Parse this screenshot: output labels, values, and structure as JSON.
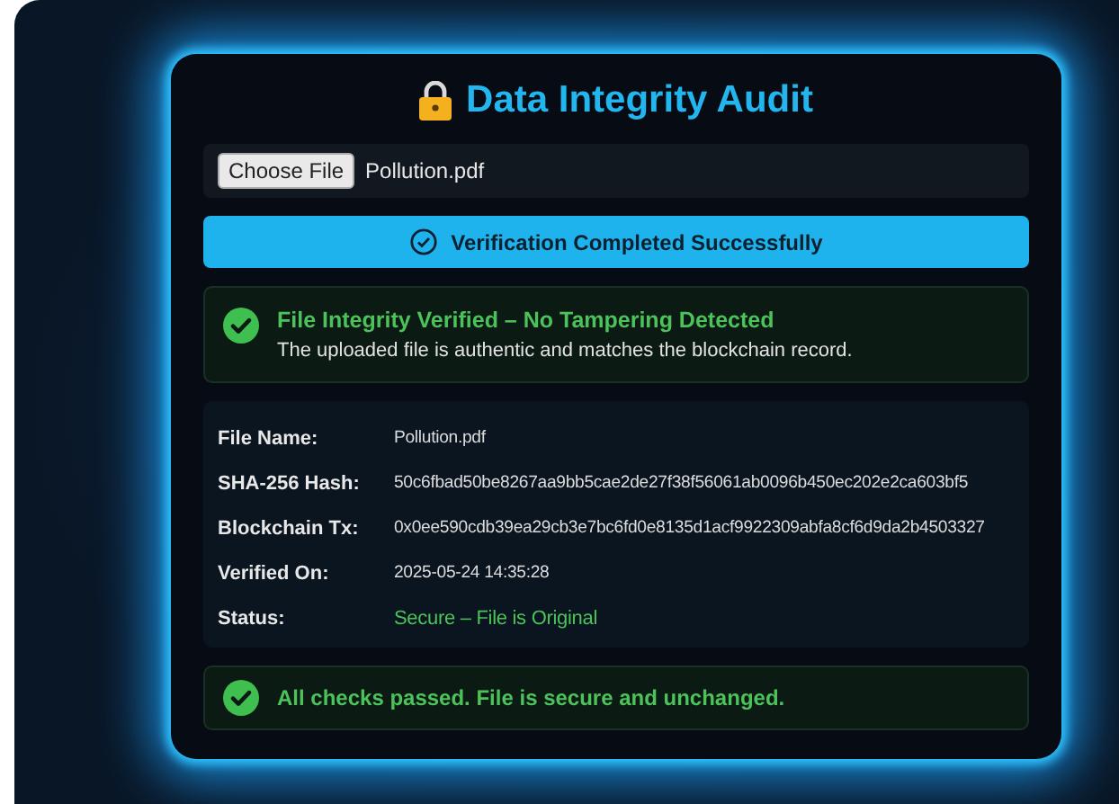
{
  "title": "Data Integrity Audit",
  "file_input": {
    "button": "Choose File",
    "file_name": "Pollution.pdf"
  },
  "banner": {
    "label": "Verification Completed Successfully"
  },
  "result": {
    "heading": "File Integrity Verified – No Tampering Detected",
    "message": "The uploaded file is authentic and matches the blockchain record."
  },
  "details": [
    {
      "label": "File Name:",
      "value": "Pollution.pdf",
      "kind": "plain"
    },
    {
      "label": "SHA-256 Hash:",
      "value": "50c6fbad50be8267aa9bb5cae2de27f38f56061ab0096b450ec202e2ca603bf5",
      "kind": "plain"
    },
    {
      "label": "Blockchain Tx:",
      "value": "0x0ee590cdb39ea29cb3e7bc6fd0e8135d1acf9922309abfa8cf6d9da2b4503327",
      "kind": "plain"
    },
    {
      "label": "Verified On:",
      "value": "2025-05-24 14:35:28",
      "kind": "plain"
    },
    {
      "label": "Status:",
      "value": "Secure – File is Original",
      "kind": "status"
    }
  ],
  "footer": {
    "message": "All checks passed. File is secure and unchanged."
  }
}
